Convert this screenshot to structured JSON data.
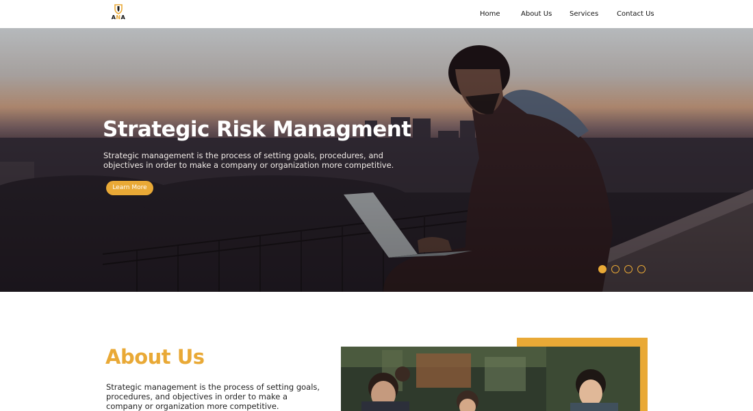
{
  "header": {
    "logo": {
      "text_left": "A",
      "text_mid": "N",
      "text_right": "A",
      "icon": "shield-icon"
    },
    "nav": [
      {
        "label": "Home"
      },
      {
        "label": "About Us"
      },
      {
        "label": "Services"
      },
      {
        "label": "Contact Us"
      }
    ]
  },
  "hero": {
    "title": "Strategic Risk Managment",
    "description": "Strategic management is the process of setting goals, procedures, and objectives in order to make a company or organization more competitive.",
    "button_label": "Learn More",
    "slides": {
      "count": 4,
      "active_index": 0
    },
    "image": "man-working-on-laptop-city-sunset-photo"
  },
  "about": {
    "title": "About Us",
    "text": "Strategic management is the process of setting goals, procedures, and objectives in order to make a company or organization more competitive.",
    "image": "team-meeting-cafe-photo"
  },
  "colors": {
    "accent": "#e9a936",
    "text_dark": "#222222",
    "white": "#ffffff"
  }
}
